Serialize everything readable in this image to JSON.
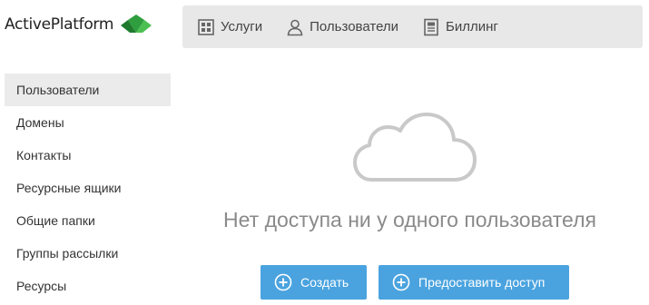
{
  "app": {
    "logo_text": "ActivePlatform"
  },
  "topnav": {
    "items": [
      {
        "label": "Услуги",
        "icon": "services-icon"
      },
      {
        "label": "Пользователи",
        "icon": "user-icon"
      },
      {
        "label": "Биллинг",
        "icon": "billing-icon"
      }
    ]
  },
  "sidebar": {
    "items": [
      {
        "label": "Пользователи",
        "active": true
      },
      {
        "label": "Домены"
      },
      {
        "label": "Контакты"
      },
      {
        "label": "Ресурсные ящики"
      },
      {
        "label": "Общие папки"
      },
      {
        "label": "Группы рассылки"
      },
      {
        "label": "Ресурсы"
      }
    ]
  },
  "main": {
    "empty_icon": "cloud-icon",
    "empty_message": "Нет доступа ни у одного пользователя",
    "create_label": "Создать",
    "grant_label": "Предоставить доступ"
  },
  "colors": {
    "accent": "#4aa3df",
    "nav_bg": "#e8e8e8",
    "logo_green": "#2e9e3e"
  }
}
